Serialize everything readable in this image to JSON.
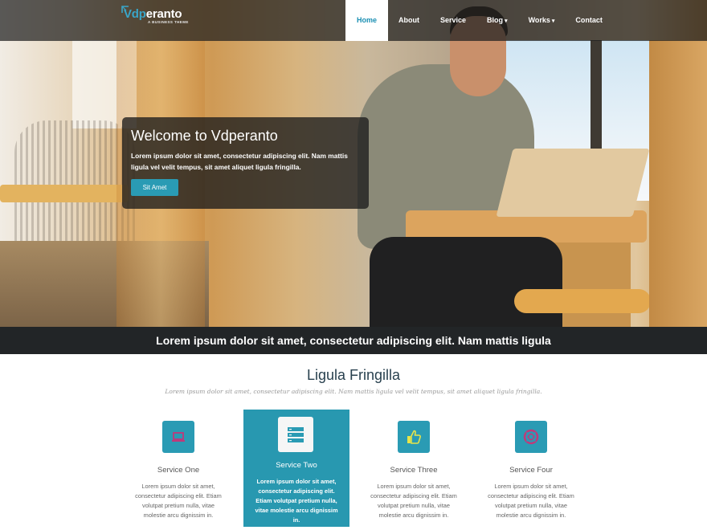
{
  "brand": {
    "name_part1": "Vdp",
    "name_part2": "eranto",
    "tagline": "A BUSINESS THEME"
  },
  "nav": [
    {
      "label": "Home",
      "active": true,
      "dropdown": false
    },
    {
      "label": "About",
      "active": false,
      "dropdown": false
    },
    {
      "label": "Service",
      "active": false,
      "dropdown": false
    },
    {
      "label": "Blog",
      "active": false,
      "dropdown": true
    },
    {
      "label": "Works",
      "active": false,
      "dropdown": true
    },
    {
      "label": "Contact",
      "active": false,
      "dropdown": false
    }
  ],
  "hero": {
    "title": "Welcome to Vdperanto",
    "text": "Lorem ipsum dolor sit amet, consectetur adipiscing elit. Nam mattis ligula vel velit tempus, sit amet aliquet ligula fringilla.",
    "button": "Sit Amet"
  },
  "strip_text": "Lorem ipsum dolor sit amet, consectetur adipiscing elit. Nam mattis ligula",
  "section": {
    "title": "Ligula Fringilla",
    "subtitle": "Lorem ipsum dolor sit amet, consectetur adipiscing elit. Nam mattis ligula vel velit tempus, sit amet aliquet ligula fringilla."
  },
  "services": [
    {
      "title": "Service One",
      "icon": "laptop-icon",
      "text": "Lorem ipsum dolor sit amet, consectetur adipiscing elit. Etiam volutpat pretium nulla, vitae molestie arcu dignissim in.",
      "highlighted": false
    },
    {
      "title": "Service Two",
      "icon": "server-icon",
      "text": "Lorem ipsum dolor sit amet, consectetur adipiscing elit. Etiam volutpat pretium nulla, vitae molestie arcu dignissim in.",
      "highlighted": true
    },
    {
      "title": "Service Three",
      "icon": "thumbs-up-icon",
      "text": "Lorem ipsum dolor sit amet, consectetur adipiscing elit. Etiam volutpat pretium nulla, vitae molestie arcu dignissim in.",
      "highlighted": false
    },
    {
      "title": "Service Four",
      "icon": "life-ring-icon",
      "text": "Lorem ipsum dolor sit amet, consectetur adipiscing elit. Etiam volutpat pretium nulla, vitae molestie arcu dignissim in.",
      "highlighted": false
    }
  ],
  "colors": {
    "accent": "#2a9bb4",
    "icon_pink": "#c0397a",
    "icon_yellow": "#e7e44a",
    "strip": "#222527",
    "heading": "#29414f"
  }
}
